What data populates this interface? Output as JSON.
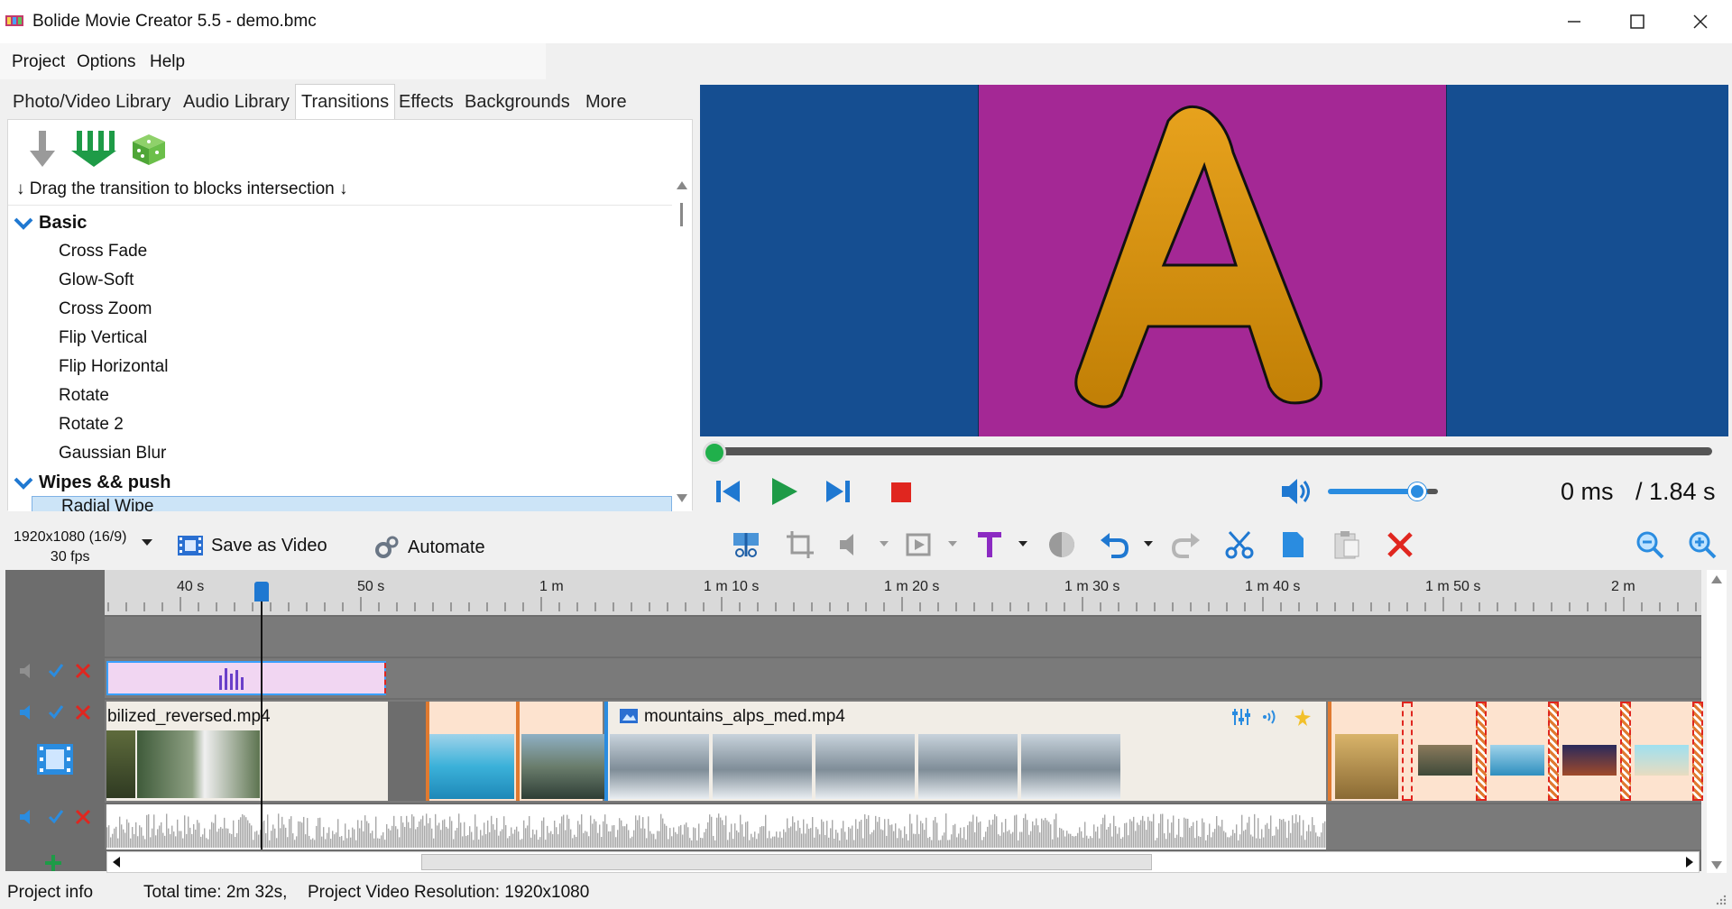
{
  "window": {
    "title": "Bolide Movie Creator 5.5 - demo.bmc",
    "minimize_icon": "minimize-icon",
    "maximize_icon": "maximize-icon",
    "close_icon": "close-icon"
  },
  "menu": {
    "items": [
      "Project",
      "Options",
      "Help"
    ]
  },
  "tabs": [
    {
      "label": "Photo/Video Library",
      "active": false
    },
    {
      "label": "Audio Library",
      "active": false
    },
    {
      "label": "Transitions",
      "active": true
    },
    {
      "label": "Effects",
      "active": false
    },
    {
      "label": "Backgrounds",
      "active": false
    },
    {
      "label": "More",
      "active": false
    }
  ],
  "transitions": {
    "hint": "↓ Drag the transition to blocks intersection ↓",
    "groups": [
      {
        "name": "Basic",
        "items": [
          "Cross Fade",
          "Glow-Soft",
          "Cross Zoom",
          "Flip Vertical",
          "Flip Horizontal",
          "Rotate",
          "Rotate 2",
          "Gaussian Blur"
        ]
      },
      {
        "name": "Wipes && push",
        "items": [
          "Radial Wipe"
        ]
      }
    ],
    "selected": "Radial Wipe"
  },
  "preview": {
    "letter": "A",
    "background_color": "#154e91",
    "clip_color": "#a42895",
    "letter_color": "#d99208"
  },
  "playback": {
    "current_time": "0 ms",
    "total_time": "/ 1.84 s",
    "volume_fraction": 0.72,
    "progress_fraction": 0.0
  },
  "toolbar": {
    "resolution": "1920x1080 (16/9)",
    "fps": "30 fps",
    "save_label": "Save as Video",
    "automate_label": "Automate"
  },
  "timeline": {
    "ruler_labels": [
      "40 s",
      "50 s",
      "1 m",
      "1 m 10 s",
      "1 m 20 s",
      "1 m 30 s",
      "1 m 40 s",
      "1 m 50 s",
      "2 m"
    ],
    "video_clip_1": "bilized_reversed.mp4",
    "video_clip_2": "mountains_alps_med.mp4"
  },
  "status": {
    "project_info": "Project info",
    "total_time": "Total time: 2m 32s,",
    "resolution": "Project Video Resolution:  1920x1080"
  }
}
